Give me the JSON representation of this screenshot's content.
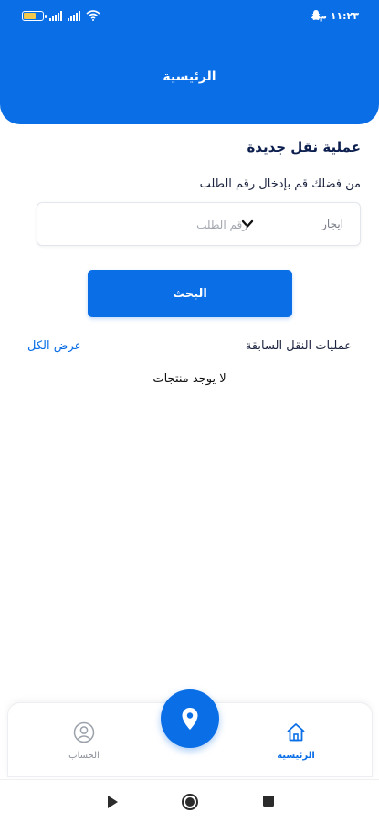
{
  "status_bar": {
    "time": "١١:٢٣ م",
    "icons": [
      "battery-icon",
      "signal-icon",
      "signal-icon",
      "wifi-icon",
      "snapchat-icon"
    ]
  },
  "header": {
    "title": "الرئيسية"
  },
  "main": {
    "section_title": "عملية نقل جديدة",
    "hint": "من فضلك قم بإدخال رقم الطلب",
    "type_select": {
      "selected": "ايجار"
    },
    "order_input": {
      "placeholder": "رقم الطلب",
      "value": ""
    },
    "search_button": "البحث",
    "previous_transfers_title": "عمليات النقل السابقة",
    "view_all": "عرض الكل",
    "empty_message": "لا يوجد منتجات"
  },
  "bottom_nav": {
    "items": [
      {
        "label": "الرئيسية",
        "icon": "home-icon",
        "active": true
      },
      {
        "label": "الحساب",
        "icon": "user-icon",
        "active": false
      }
    ],
    "fab_icon": "location-pin-icon"
  },
  "system_nav": [
    "back-icon",
    "home-circle-icon",
    "recents-icon"
  ],
  "colors": {
    "primary": "#0a6ee6",
    "text": "#1c2440",
    "muted": "#8a8f99"
  }
}
